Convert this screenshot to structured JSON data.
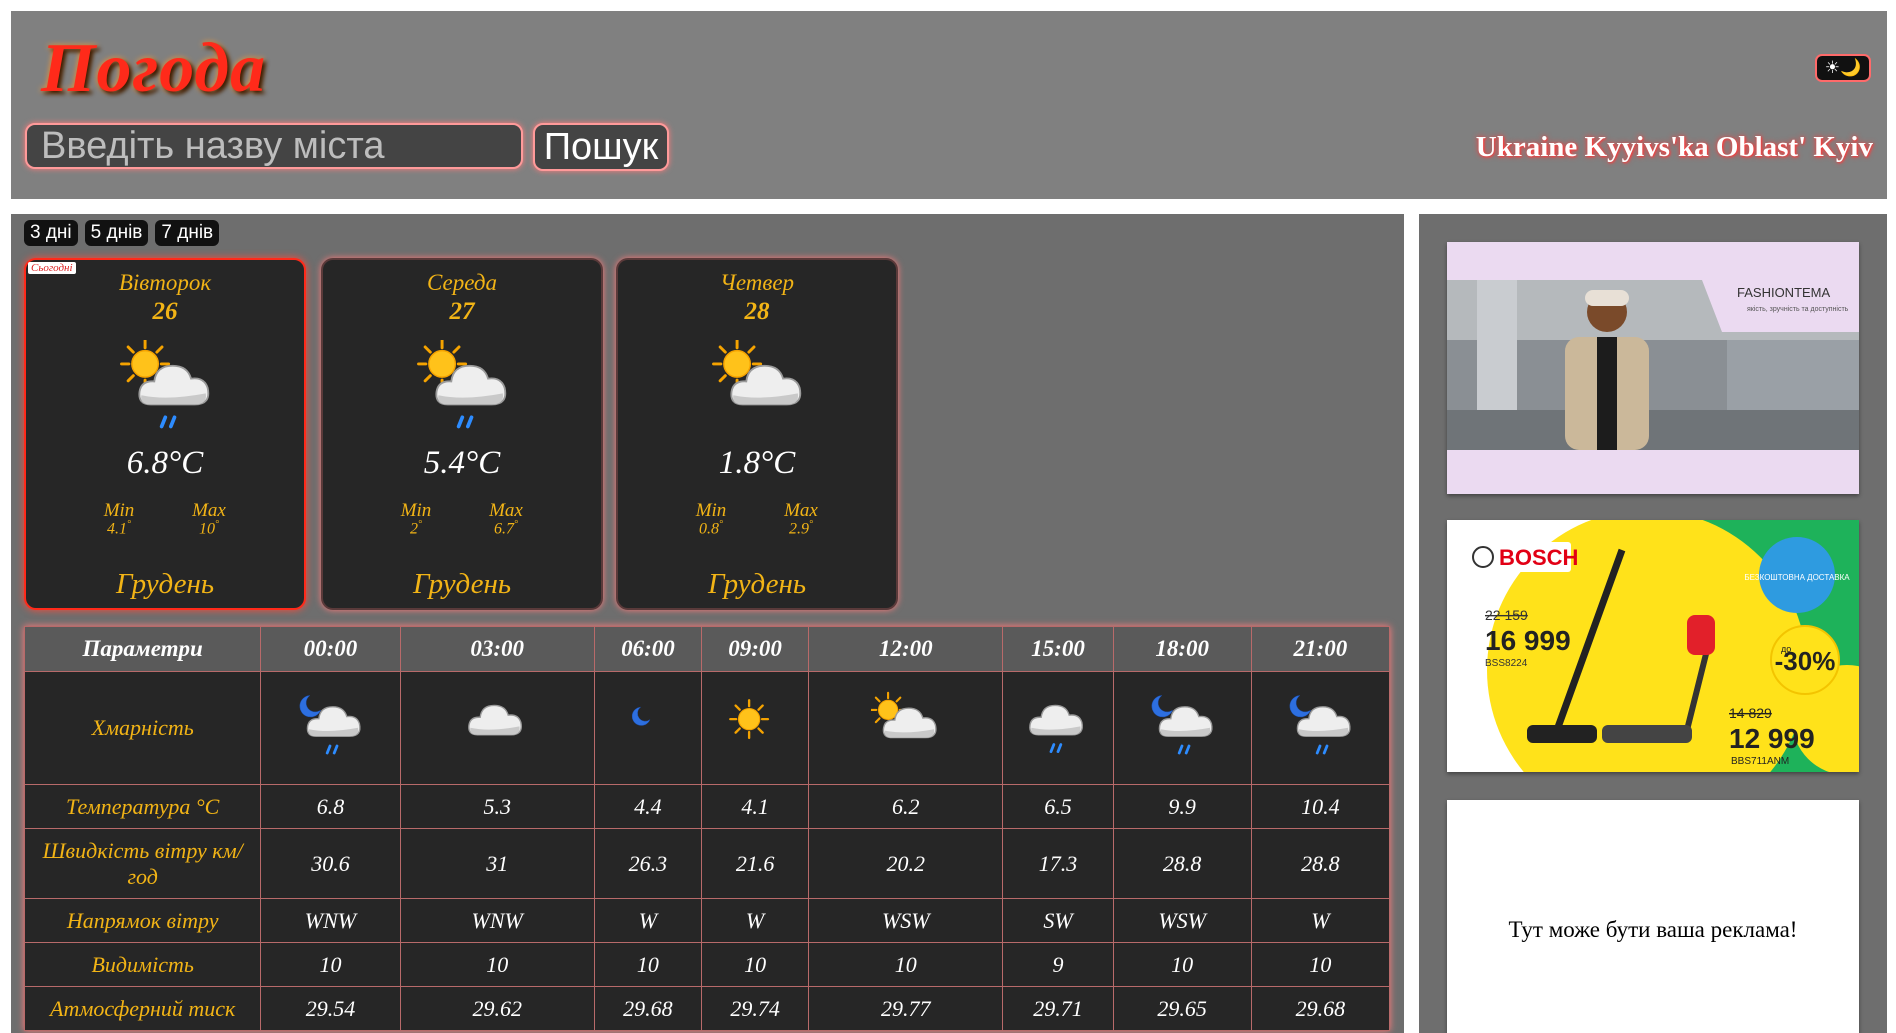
{
  "header": {
    "logo": "Погода",
    "search_placeholder": "Введіть назву міста",
    "search_button": "Пошук",
    "theme_toggle": "☀🌙",
    "location": "Ukraine Kyyivs'ka Oblast' Kyiv"
  },
  "ranges": [
    "3 дні",
    "5 днів",
    "7 днів"
  ],
  "today_badge": "Сьогодні",
  "days": [
    {
      "name": "Вівторок",
      "num": "26",
      "temp": "6.8°C",
      "min_label": "Min",
      "max_label": "Max",
      "min": "4.1",
      "max": "10",
      "month": "Грудень",
      "icon": "sun-cloud-rain-icon"
    },
    {
      "name": "Середа",
      "num": "27",
      "temp": "5.4°C",
      "min_label": "Min",
      "max_label": "Max",
      "min": "2",
      "max": "6.7",
      "month": "Грудень",
      "icon": "sun-cloud-rain-icon"
    },
    {
      "name": "Четвер",
      "num": "28",
      "temp": "1.8°C",
      "min_label": "Min",
      "max_label": "Max",
      "min": "0.8",
      "max": "2.9",
      "month": "Грудень",
      "icon": "sun-cloud-icon"
    }
  ],
  "table": {
    "headers": [
      "Параметри",
      "00:00",
      "03:00",
      "06:00",
      "09:00",
      "12:00",
      "15:00",
      "18:00",
      "21:00"
    ],
    "icon_row_label": "Хмарність",
    "icons": [
      "moon-cloud-rain-icon",
      "cloud-icon",
      "moon-icon",
      "sun-icon",
      "sun-cloud-icon",
      "cloud-rain-icon",
      "moon-cloud-rain-icon",
      "moon-cloud-rain-icon"
    ],
    "rows": [
      {
        "label": "Температура °C",
        "values": [
          "6.8",
          "5.3",
          "4.4",
          "4.1",
          "6.2",
          "6.5",
          "9.9",
          "10.4"
        ]
      },
      {
        "label": "Швидкість вітру км/год",
        "values": [
          "30.6",
          "31",
          "26.3",
          "21.6",
          "20.2",
          "17.3",
          "28.8",
          "28.8"
        ]
      },
      {
        "label": "Напрямок вітру",
        "values": [
          "WNW",
          "WNW",
          "W",
          "W",
          "WSW",
          "SW",
          "WSW",
          "W"
        ]
      },
      {
        "label": "Видимість",
        "values": [
          "10",
          "10",
          "10",
          "10",
          "10",
          "9",
          "10",
          "10"
        ]
      },
      {
        "label": "Атмосферний тиск",
        "values": [
          "29.54",
          "29.62",
          "29.68",
          "29.74",
          "29.77",
          "29.71",
          "29.65",
          "29.68"
        ]
      }
    ]
  },
  "ads": {
    "ad1_brand": "FASHIONTEMA",
    "ad1_tag": "якість, зручність та доступність",
    "ad2_brand": "BOSCH",
    "ad2_delivery": "БЕЗКОШТОВНА ДОСТАВКА",
    "ad2_old1": "22 159",
    "ad2_new1": "16 999",
    "ad2_model1": "BSS8224",
    "ad2_discount_prefix": "до",
    "ad2_discount": "-30%",
    "ad2_old2": "14 829",
    "ad2_new2": "12 999",
    "ad2_model2": "BBS711ANM",
    "ad3_text": "Тут може бути ваша реклама!"
  },
  "colors": {
    "accent": "#f2b416",
    "header_bg": "#808080",
    "panel_bg": "#6e6e6e",
    "card_bg": "#262626",
    "glow": "#ff7a7a"
  }
}
